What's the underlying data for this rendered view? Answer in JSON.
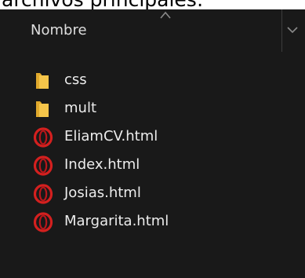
{
  "page": {
    "caption": "archivos principales:"
  },
  "header": {
    "name_column": "Nombre"
  },
  "files": [
    {
      "name": "css",
      "icon": "folder-icon"
    },
    {
      "name": "mult",
      "icon": "folder-icon"
    },
    {
      "name": "EliamCV.html",
      "icon": "opera-icon"
    },
    {
      "name": "Index.html",
      "icon": "opera-icon"
    },
    {
      "name": "Josias.html",
      "icon": "opera-icon"
    },
    {
      "name": "Margarita.html",
      "icon": "opera-icon"
    }
  ],
  "colors": {
    "background": "#191919",
    "text": "#ececec",
    "folder": "#f5c54a",
    "opera": "#d4201f"
  }
}
